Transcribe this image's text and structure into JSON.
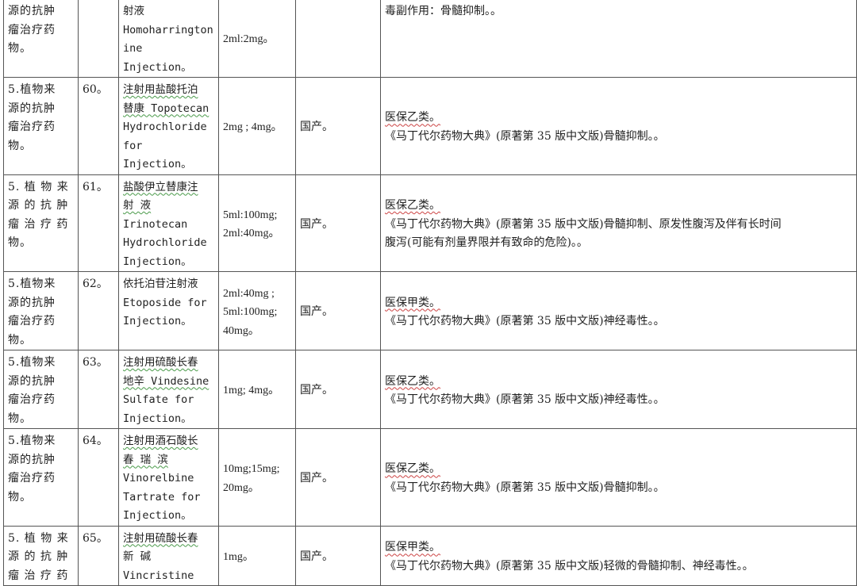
{
  "rows": [
    {
      "category": [
        "源的抗肿",
        "瘤治疗药",
        "物。"
      ],
      "no": "",
      "name": [
        "射液",
        "Homoharrington",
        "ine Injection。"
      ],
      "spec": "2ml:2mg。",
      "origin": "",
      "notes": [
        "毒副作用：骨髓抑制。。"
      ]
    },
    {
      "category": [
        "5.植物来",
        "源的抗肿",
        "瘤治疗药",
        "物。"
      ],
      "no": "60。",
      "name": [
        "注射用盐酸托泊",
        "替康 Topotecan",
        "Hydrochloride",
        "for Injection。"
      ],
      "spec": "2mg ; 4mg。",
      "origin": "国产。",
      "notes": [
        "医保乙类。",
        "《马丁代尔药物大典》(原著第 35 版中文版)骨髓抑制。。"
      ]
    },
    {
      "category": [
        "5. 植 物 来",
        "源 的 抗 肿",
        "瘤 治 疗 药",
        "物。"
      ],
      "no": "61。",
      "name": [
        "盐酸伊立替康注",
        "射  液",
        "Irinotecan",
        "Hydrochloride",
        "Injection。"
      ],
      "spec": "5ml:100mg;\n2ml:40mg。",
      "origin": "国产。",
      "notes": [
        "医保乙类。",
        "《马丁代尔药物大典》(原著第 35 版中文版)骨髓抑制、原发性腹泻及伴有长时间",
        "腹泻(可能有剂量界限并有致命的危险)。。"
      ]
    },
    {
      "category": [
        "5.植物来",
        "源的抗肿",
        "瘤治疗药",
        "物。"
      ],
      "no": "62。",
      "name": [
        "依托泊苷注射液",
        "Etoposide for",
        "Injection。"
      ],
      "spec": "2ml:40mg ;\n5ml:100mg;\n40mg。",
      "origin": "国产。",
      "notes": [
        "医保甲类。",
        "《马丁代尔药物大典》(原著第 35 版中文版)神经毒性。。"
      ]
    },
    {
      "category": [
        "5.植物来",
        "源的抗肿",
        "瘤治疗药",
        "物。"
      ],
      "no": "63。",
      "name": [
        "注射用硫酸长春",
        "地辛 Vindesine",
        "Sulfate for",
        "Injection。"
      ],
      "spec": "1mg; 4mg。",
      "origin": "国产。",
      "notes": [
        "医保乙类。",
        "《马丁代尔药物大典》(原著第 35 版中文版)神经毒性。。"
      ]
    },
    {
      "category": [
        "5.植物来",
        "源的抗肿",
        "瘤治疗药",
        "物。"
      ],
      "no": "64。",
      "name": [
        "注射用酒石酸长",
        "春  瑞  滨",
        "Vinorelbine",
        "Tartrate for",
        "Injection。"
      ],
      "spec": "10mg;15mg;\n20mg。",
      "origin": "国产。",
      "notes": [
        "医保乙类。",
        "《马丁代尔药物大典》(原著第 35 版中文版)骨髓抑制。。"
      ]
    },
    {
      "category": [
        "5. 植 物 来",
        "源 的 抗 肿",
        "瘤 治 疗 药"
      ],
      "no": "65。",
      "name": [
        "注射用硫酸长春",
        "新  碱",
        "Vincristine"
      ],
      "spec": "1mg。",
      "origin": "国产。",
      "notes": [
        "医保甲类。",
        "《马丁代尔药物大典》(原著第 35 版中文版)轻微的骨髓抑制、神经毒性。。"
      ]
    }
  ]
}
